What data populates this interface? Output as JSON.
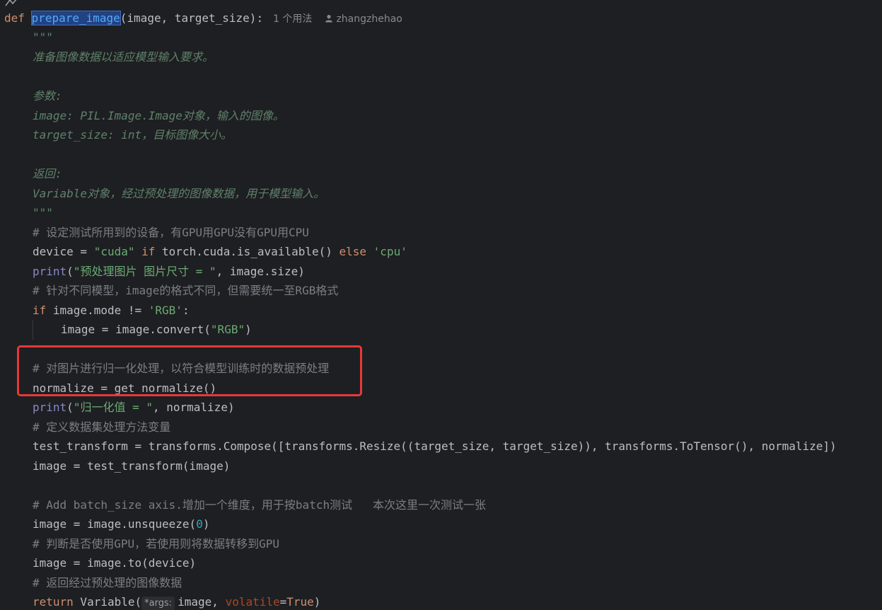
{
  "code": {
    "def_line": {
      "kw": "def",
      "fn_name": "prepare_image",
      "signature": "(image, target_size):",
      "usage_hint": "1 个用法",
      "author": "zhangzhehao"
    },
    "doc_open": "\"\"\"",
    "doc_desc": "准备图像数据以适应模型输入要求。",
    "doc_params_label": "参数:",
    "doc_param1": "image: PIL.Image.Image对象，输入的图像。",
    "doc_param2": "target_size: int，目标图像大小。",
    "doc_return_label": "返回:",
    "doc_return": "Variable对象，经过预处理的图像数据，用于模型输入。",
    "doc_close": "\"\"\"",
    "c_device": "# 设定测试所用到的设备，有GPU用GPU没有GPU用CPU",
    "device_line": {
      "a": "device = ",
      "s1": "\"cuda\"",
      "k1": "if",
      "b": " torch.cuda.is_available() ",
      "k2": "else",
      "s2": "'cpu'"
    },
    "print1": {
      "fn": "print",
      "open": "(",
      "s": "\"预处理图片 图片尺寸 = \"",
      "rest": ", image.size)"
    },
    "c_rgb": "# 针对不同模型，image的格式不同，但需要统一至RGB格式",
    "if_line": {
      "k": "if",
      "a": " image.mode != ",
      "s": "'RGB'",
      "b": ":"
    },
    "convert_line": {
      "a": "image = image.convert(",
      "s": "\"RGB\"",
      "b": ")"
    },
    "c_normalize": "# 对图片进行归一化处理，以符合模型训练时的数据预处理",
    "normalize_line": "normalize = get_normalize()",
    "print2": {
      "fn": "print",
      "open": "(",
      "s": "\"归一化值 = \"",
      "rest": ", normalize)"
    },
    "c_transform": "# 定义数据集处理方法变量",
    "transform_line": "test_transform = transforms.Compose([transforms.Resize((target_size, target_size)), transforms.ToTensor(), normalize])",
    "apply_line": "image = test_transform(image)",
    "c_batch": "# Add batch_size axis.增加一个维度，用于按batch测试   本次这里一次测试一张",
    "unsqueeze_line": {
      "a": "image = image.unsqueeze(",
      "n": "0",
      "b": ")"
    },
    "c_gpu": "# 判断是否使用GPU，若使用则将数据转移到GPU",
    "to_line": "image = image.to(device)",
    "c_return": "# 返回经过预处理的图像数据",
    "return_line": {
      "k": "return",
      "a": " Variable(",
      "hint": "*args:",
      "b": "image, ",
      "p": "volatile",
      "eq": "=",
      "k2": "True",
      "c": ")"
    }
  },
  "colors": {
    "background": "#1e1f22",
    "keyword": "#cf8e6d",
    "function": "#56a8f5",
    "string": "#6aab73",
    "number": "#2aacb8",
    "builtin": "#8888c6",
    "comment": "#7a7e85",
    "docstring": "#5f826b",
    "highlight_box": "#e5393a"
  },
  "icons": {
    "gutter": "debug-marker-icon",
    "author": "user-icon"
  }
}
